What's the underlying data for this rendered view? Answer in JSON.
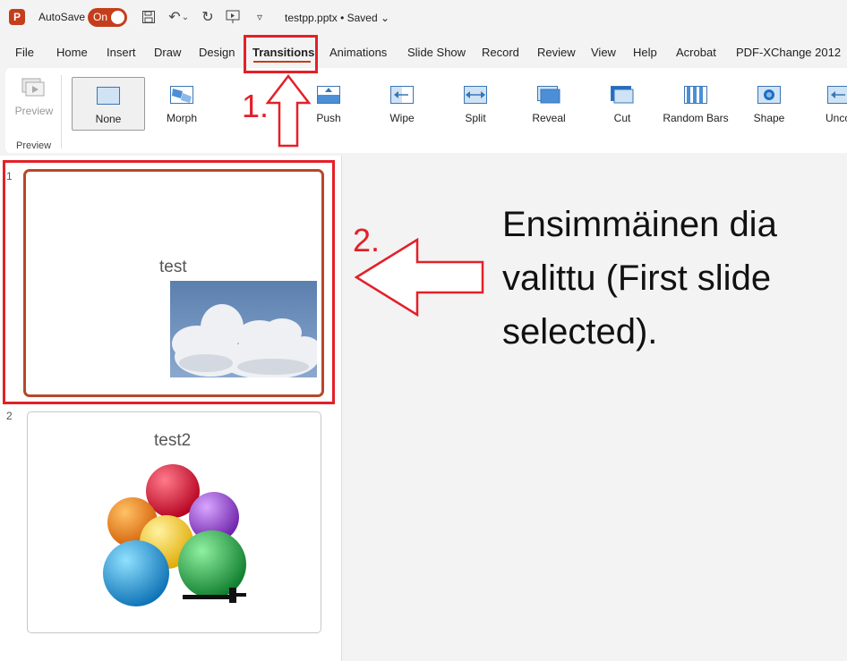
{
  "titlebar": {
    "autosave_label": "AutoSave",
    "toggle_state": "On",
    "filename": "testpp.pptx",
    "status": "Saved",
    "separator": "•"
  },
  "tabs": [
    {
      "label": "File"
    },
    {
      "label": "Home"
    },
    {
      "label": "Insert"
    },
    {
      "label": "Draw"
    },
    {
      "label": "Design"
    },
    {
      "label": "Transitions",
      "active": true
    },
    {
      "label": "Animations"
    },
    {
      "label": "Slide Show"
    },
    {
      "label": "Record"
    },
    {
      "label": "Review"
    },
    {
      "label": "View"
    },
    {
      "label": "Help"
    },
    {
      "label": "Acrobat"
    },
    {
      "label": "PDF-XChange 2012"
    }
  ],
  "ribbon": {
    "preview_label": "Preview",
    "group_label": "Preview",
    "transitions": [
      {
        "label": "None",
        "icon": "none-transition-icon",
        "selected": true
      },
      {
        "label": "Morph",
        "icon": "morph-transition-icon"
      },
      {
        "label": "Push",
        "icon": "push-transition-icon"
      },
      {
        "label": "Wipe",
        "icon": "wipe-transition-icon"
      },
      {
        "label": "Split",
        "icon": "split-transition-icon"
      },
      {
        "label": "Reveal",
        "icon": "reveal-transition-icon"
      },
      {
        "label": "Cut",
        "icon": "cut-transition-icon"
      },
      {
        "label": "Random Bars",
        "icon": "random-bars-transition-icon"
      },
      {
        "label": "Shape",
        "icon": "shape-transition-icon"
      },
      {
        "label": "Unco",
        "icon": "uncover-transition-icon"
      }
    ]
  },
  "slides": [
    {
      "number": "1",
      "title": "test",
      "image": "clouds-image",
      "selected": true
    },
    {
      "number": "2",
      "title": "test2",
      "image": "colored-balls-image"
    }
  ],
  "annotations": {
    "step1": "1.",
    "step2": "2.",
    "text_lines": [
      "Ensimmäinen dia",
      "valittu (First slide",
      "selected)."
    ]
  },
  "colors": {
    "accent": "#c43e1c",
    "annotation_red": "#e32028",
    "selected_thumb_border": "#b7472a"
  }
}
